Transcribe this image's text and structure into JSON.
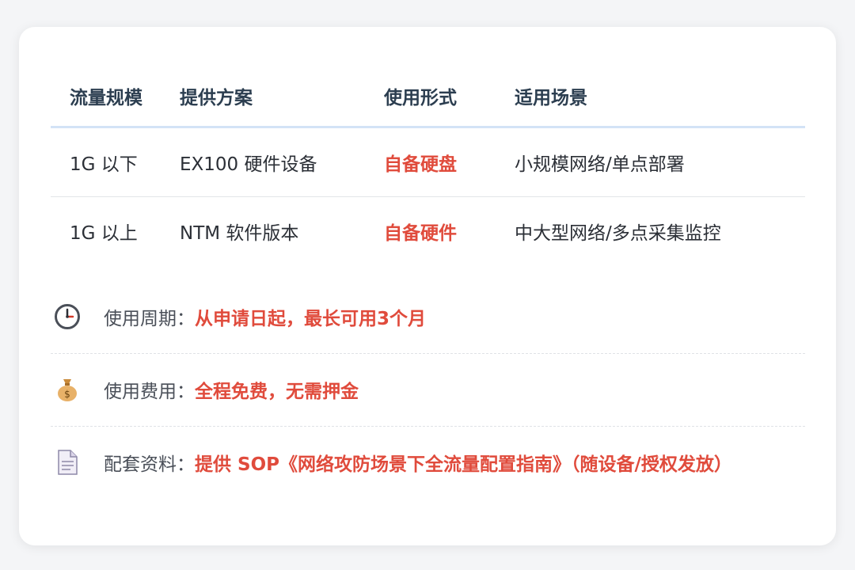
{
  "table": {
    "headers": [
      "流量规模",
      "提供方案",
      "使用形式",
      "适用场景"
    ],
    "rows": [
      [
        "1G 以下",
        "EX100 硬件设备",
        "自备硬盘",
        "小规模网络/单点部署"
      ],
      [
        "1G 以上",
        "NTM 软件版本",
        "自备硬件",
        "中大型网络/多点采集监控"
      ]
    ]
  },
  "info": [
    {
      "icon": "clock-icon",
      "label": "使用周期：",
      "value": "从申请日起，最长可用3个月"
    },
    {
      "icon": "money-bag-icon",
      "label": "使用费用：",
      "value": "全程免费，无需押金"
    },
    {
      "icon": "document-icon",
      "label": "配套资料：",
      "value": "提供 SOP《网络攻防场景下全流量配置指南》（随设备/授权发放）"
    }
  ],
  "colors": {
    "accent": "#e04b3c",
    "header_border": "#d3e3f6",
    "heading": "#2c3e50"
  }
}
